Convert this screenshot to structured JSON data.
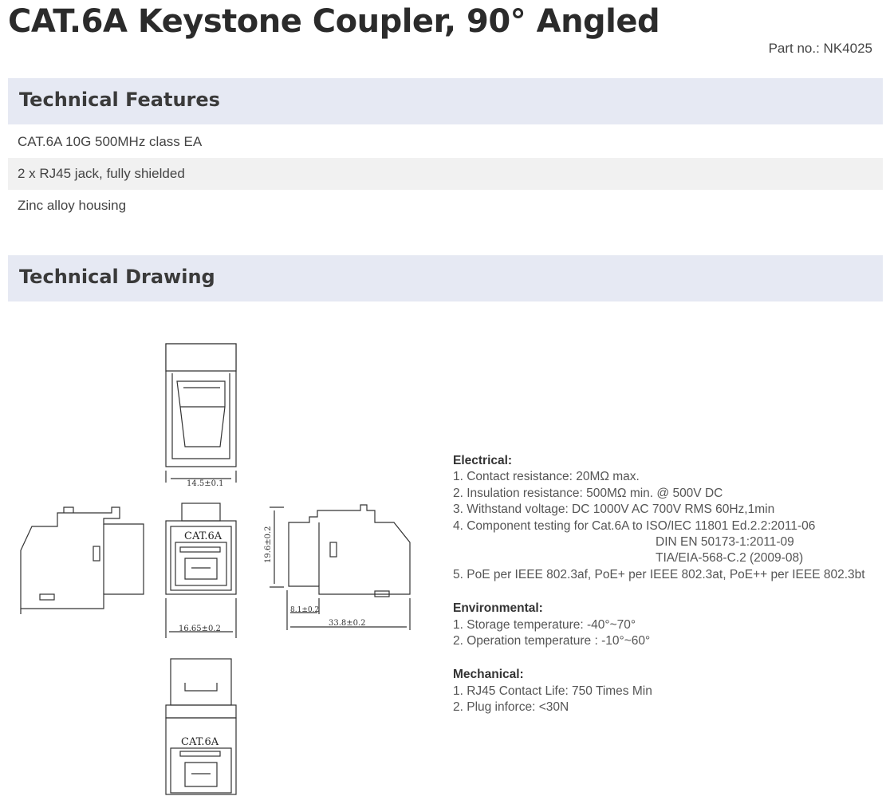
{
  "header": {
    "title": "CAT.6A Keystone Coupler, 90° Angled",
    "part_no": "Part no.: NK4025"
  },
  "features": {
    "heading": "Technical Features",
    "items": [
      "CAT.6A 10G 500MHz class EA",
      "2 x RJ45 jack, fully shielded",
      "Zinc alloy housing"
    ]
  },
  "drawing": {
    "heading": "Technical Drawing",
    "dim_top_width": "14.5±0.1",
    "dim_front_width": "16.65±0.2",
    "dim_height": "19.6±0.2",
    "dim_side_small": "8.1±0.2",
    "dim_side_length": "33.8±0.2",
    "label_front": "CAT.6A",
    "label_bottom": "CAT.6A"
  },
  "specs": {
    "electrical": {
      "heading": "Electrical:",
      "lines": [
        "1. Contact resistance: 20MΩ max.",
        "2. Insulation resistance: 500MΩ min. @ 500V DC",
        "3. Withstand voltage: DC 1000V AC 700V RMS 60Hz,1min",
        "4. Component testing for Cat.6A to ISO/IEC 11801 Ed.2.2:2011-06"
      ],
      "indented": [
        "DIN EN 50173-1:2011-09",
        "TIA/EIA-568-C.2 (2009-08)"
      ],
      "last": "5. PoE per IEEE 802.3af, PoE+ per IEEE 802.3at, PoE++ per IEEE 802.3bt"
    },
    "environmental": {
      "heading": "Environmental:",
      "lines": [
        "1. Storage temperature: -40°~70°",
        "2. Operation temperature : -10°~60°"
      ]
    },
    "mechanical": {
      "heading": "Mechanical:",
      "lines": [
        "1. RJ45 Contact Life: 750 Times Min",
        "2. Plug inforce: <30N"
      ]
    }
  }
}
